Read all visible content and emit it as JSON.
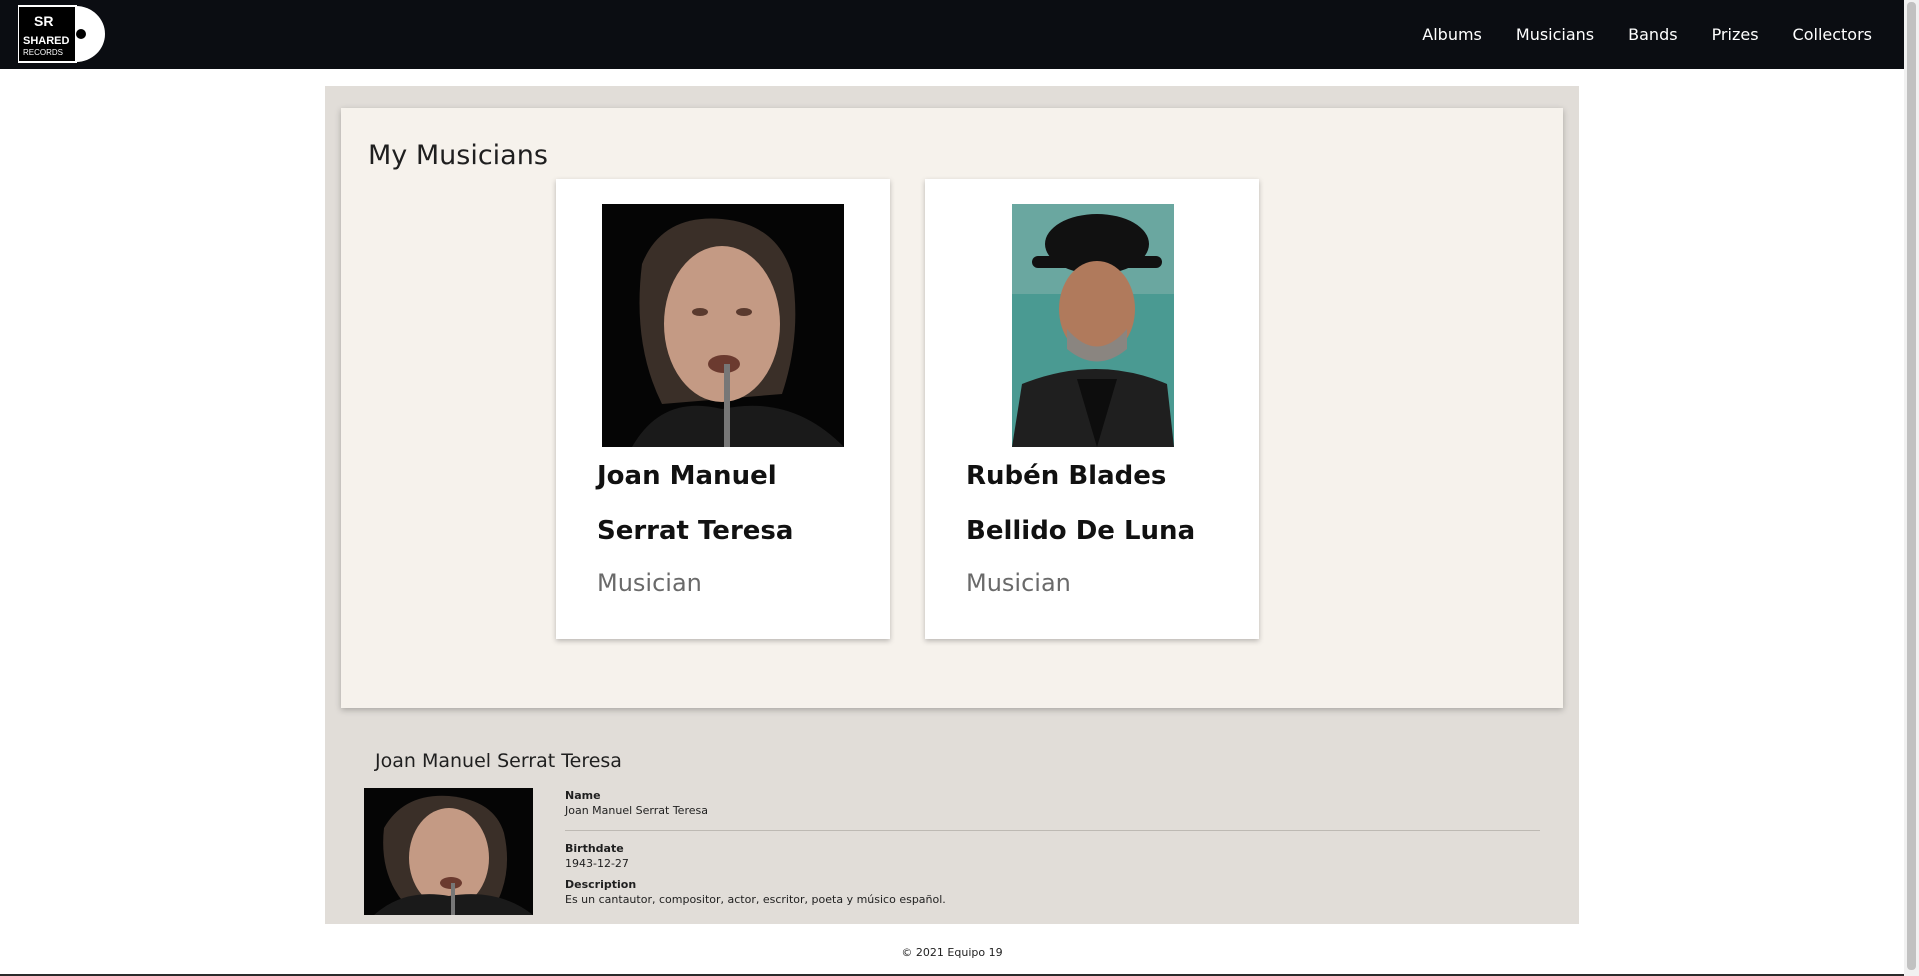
{
  "brand": {
    "logo_text_top": "SR",
    "logo_text_line1": "SHARED",
    "logo_text_line2": "RECORDS"
  },
  "nav": {
    "items": [
      "Albums",
      "Musicians",
      "Bands",
      "Prizes",
      "Collectors"
    ]
  },
  "main": {
    "title": "My Musicians",
    "cards": [
      {
        "name": "Joan Manuel Serrat Teresa",
        "role": "Musician"
      },
      {
        "name": "Rubén Blades Bellido De Luna",
        "role": "Musician"
      }
    ]
  },
  "detail": {
    "title": "Joan Manuel Serrat Teresa",
    "name_label": "Name",
    "name_value": "Joan Manuel Serrat Teresa",
    "birthdate_label": "Birthdate",
    "birthdate_value": "1943-12-27",
    "description_label": "Description",
    "description_value": "Es un cantautor, compositor, actor, escritor, poeta y músico español."
  },
  "footer": {
    "copyright": "© 2021 Equipo 19"
  }
}
